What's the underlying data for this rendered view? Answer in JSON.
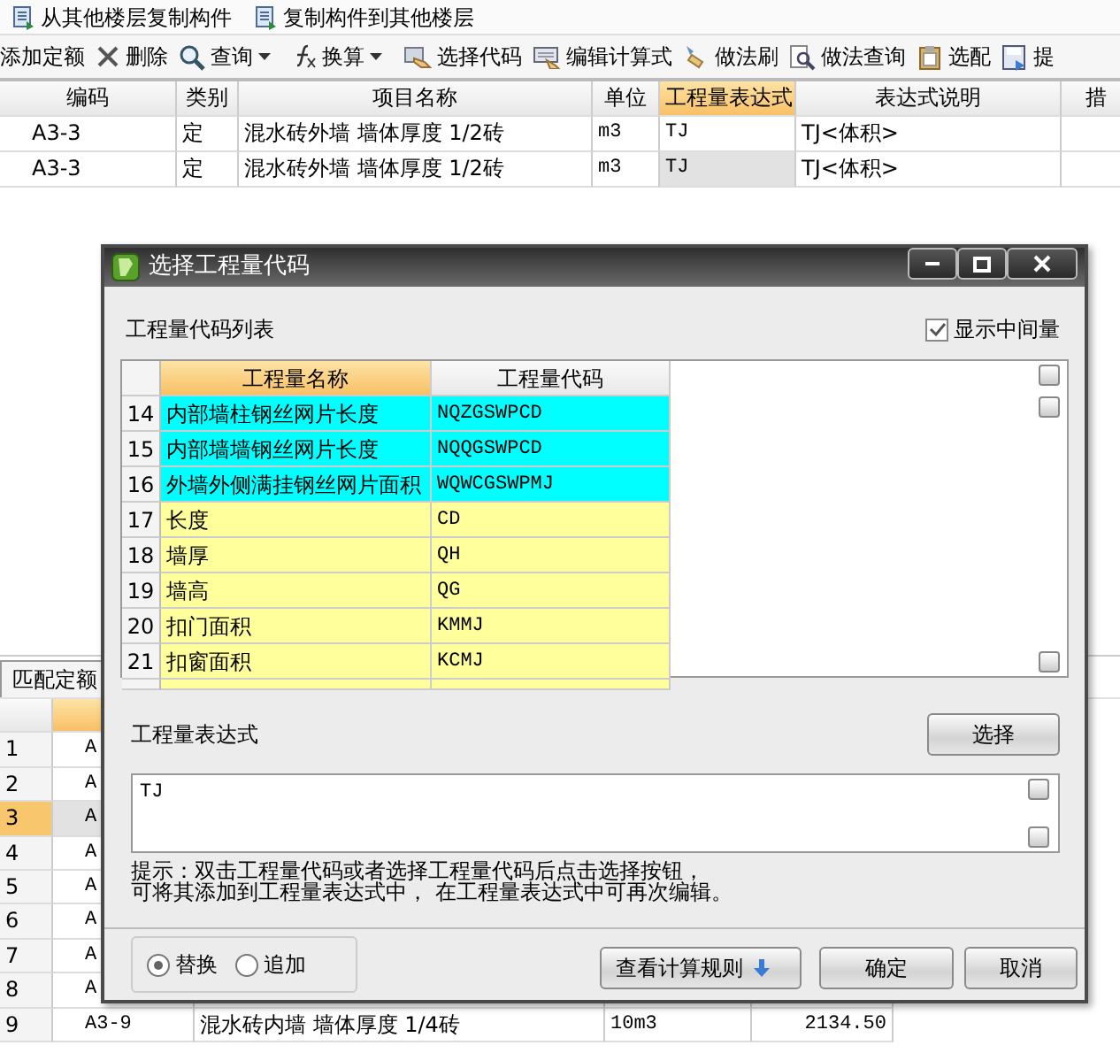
{
  "toolbar_top": [
    {
      "label": "从其他楼层复制构件"
    },
    {
      "label": "复制构件到其他楼层"
    }
  ],
  "toolbar": [
    {
      "label": "添加定额",
      "has_menu": false
    },
    {
      "label": "删除",
      "has_menu": false
    },
    {
      "label": "查询",
      "has_menu": true
    },
    {
      "label": "换算",
      "has_menu": true
    },
    {
      "label": "选择代码",
      "has_menu": false
    },
    {
      "label": "编辑计算式",
      "has_menu": false
    },
    {
      "label": "做法刷",
      "has_menu": false
    },
    {
      "label": "做法查询",
      "has_menu": false
    },
    {
      "label": "选配",
      "has_menu": false
    },
    {
      "label": "提",
      "has_menu": false
    }
  ],
  "quota_table": {
    "columns": [
      {
        "label": "编码",
        "selected": false
      },
      {
        "label": "类别",
        "selected": false
      },
      {
        "label": "项目名称",
        "selected": false
      },
      {
        "label": "单位",
        "selected": false
      },
      {
        "label": "工程量表达式",
        "selected": true
      },
      {
        "label": "表达式说明",
        "selected": false
      },
      {
        "label": "措",
        "selected": false
      }
    ],
    "rows": [
      {
        "cells": [
          "A3-3",
          "定",
          "混水砖外墙 墙体厚度 1/2砖",
          "m3",
          "TJ",
          "TJ<体积>"
        ],
        "selected": false
      },
      {
        "cells": [
          "A3-3",
          "定",
          "混水砖外墙 墙体厚度 1/2砖",
          "m3",
          "TJ",
          "TJ<体积>"
        ],
        "selected": true
      }
    ]
  },
  "lower_tab": {
    "label": "匹配定额"
  },
  "lower_grid": {
    "columns": [
      {
        "selected": false
      },
      {
        "selected": true
      }
    ],
    "rows": [
      {
        "cells": [
          "1",
          "A"
        ],
        "selected": false
      },
      {
        "cells": [
          "2",
          "A"
        ],
        "selected": false
      },
      {
        "cells": [
          "3",
          "A"
        ],
        "selected": true
      },
      {
        "cells": [
          "4",
          "A"
        ],
        "selected": false
      },
      {
        "cells": [
          "5",
          "A"
        ],
        "selected": false
      },
      {
        "cells": [
          "6",
          "A"
        ],
        "selected": false
      },
      {
        "cells": [
          "7",
          "A"
        ],
        "selected": false
      },
      {
        "cells": [
          "8",
          "A"
        ],
        "selected": false
      },
      {
        "cells": [
          "9",
          "A3-9",
          "混水砖内墙 墙体厚度 1/4砖",
          "10m3",
          "2134.50"
        ],
        "selected": false
      }
    ]
  },
  "dialog": {
    "title": "选择工程量代码",
    "list_label": "工程量代码列表",
    "show_intermediate": {
      "label": "显示中间量",
      "checked": true
    },
    "code_table": {
      "columns": [
        {
          "label": "工程量名称",
          "selected": true
        },
        {
          "label": "工程量代码",
          "selected": false
        }
      ],
      "rows": [
        {
          "number": "14",
          "name": "内部墙柱钢丝网片长度",
          "code": "NQZGSWPCD",
          "color": "#00ffff"
        },
        {
          "number": "15",
          "name": "内部墙墙钢丝网片长度",
          "code": "NQQGSWPCD",
          "color": "#00ffff"
        },
        {
          "number": "16",
          "name": "外墙外侧满挂钢丝网片面积",
          "code": "WQWCGSWPMJ",
          "color": "#00ffff"
        },
        {
          "number": "17",
          "name": "长度",
          "code": "CD",
          "color": "#ffff9c"
        },
        {
          "number": "18",
          "name": "墙厚",
          "code": "QH",
          "color": "#ffff9c"
        },
        {
          "number": "19",
          "name": "墙高",
          "code": "QG",
          "color": "#ffff9c"
        },
        {
          "number": "20",
          "name": "扣门面积",
          "code": "KMMJ",
          "color": "#ffff9c"
        },
        {
          "number": "21",
          "name": "扣窗面积",
          "code": "KCMJ",
          "color": "#ffff9c"
        }
      ]
    },
    "expression_label": "工程量表达式",
    "choose_button": "选择",
    "expression": "TJ",
    "hint": [
      "提示：双击工程量代码或者选择工程量代码后点击选择按钮，",
      "可将其添加到工程量表达式中， 在工程量表达式中可再次编辑。"
    ],
    "mode_options": [
      {
        "label": "替换",
        "selected": true
      },
      {
        "label": "追加",
        "selected": false
      }
    ],
    "rules_button": "查看计算规则",
    "ok_button": "确定",
    "cancel_button": "取消"
  }
}
